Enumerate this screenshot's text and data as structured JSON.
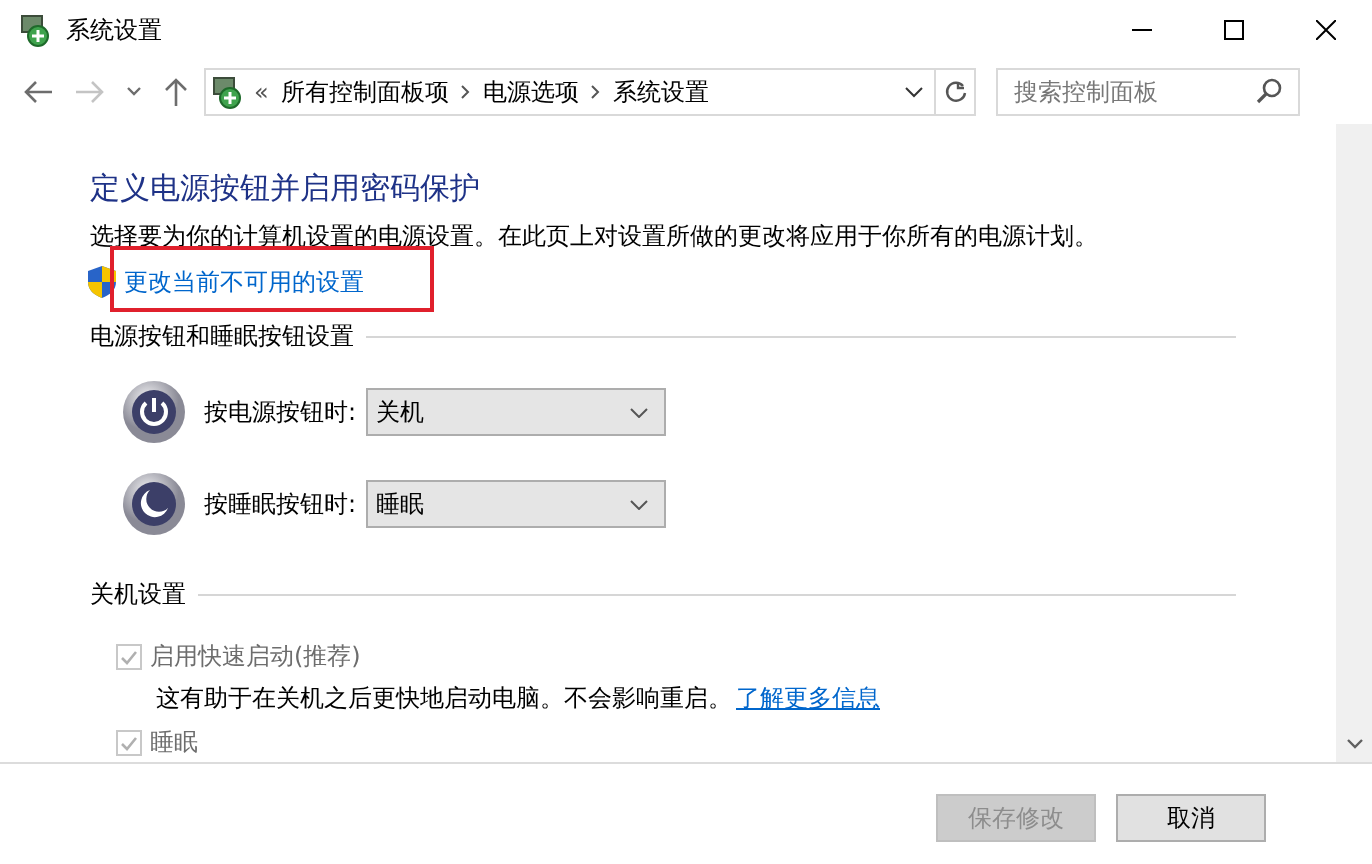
{
  "window": {
    "title": "系统设置"
  },
  "navigation": {
    "buttons": [
      {
        "kind": "back",
        "disabled": false
      },
      {
        "kind": "forward",
        "disabled": true
      },
      {
        "kind": "recent",
        "disabled": false
      },
      {
        "kind": "up",
        "disabled": false
      }
    ],
    "overflow": "«",
    "path": [
      {
        "label": "所有控制面板项"
      },
      {
        "label": "电源选项"
      },
      {
        "label": "系统设置"
      }
    ],
    "search": {
      "placeholder": "搜索控制面板"
    }
  },
  "heading": "定义电源按钮并启用密码保护",
  "description": "选择要为你的计算机设置的电源设置。在此页上对设置所做的更改将应用于你所有的电源计划。",
  "admin_link": {
    "label": "更改当前不可用的设置",
    "highlighted": true
  },
  "button_settings": {
    "title": "电源按钮和睡眠按钮设置",
    "rows": [
      {
        "kind": "power",
        "label": "按电源按钮时:",
        "value": "关机"
      },
      {
        "kind": "sleep",
        "label": "按睡眠按钮时:",
        "value": "睡眠"
      }
    ]
  },
  "shutdown_settings": {
    "title": "关机设置",
    "options": [
      {
        "label": "启用快速启动(推荐)",
        "checked": true,
        "disabled": true,
        "description": "这有助于在关机之后更快地启动电脑。不会影响重启。",
        "link": "了解更多信息"
      },
      {
        "label": "睡眠",
        "checked": true,
        "disabled": true
      }
    ]
  },
  "buttons": [
    {
      "label": "保存修改",
      "disabled": true
    },
    {
      "label": "取消",
      "disabled": false
    }
  ]
}
